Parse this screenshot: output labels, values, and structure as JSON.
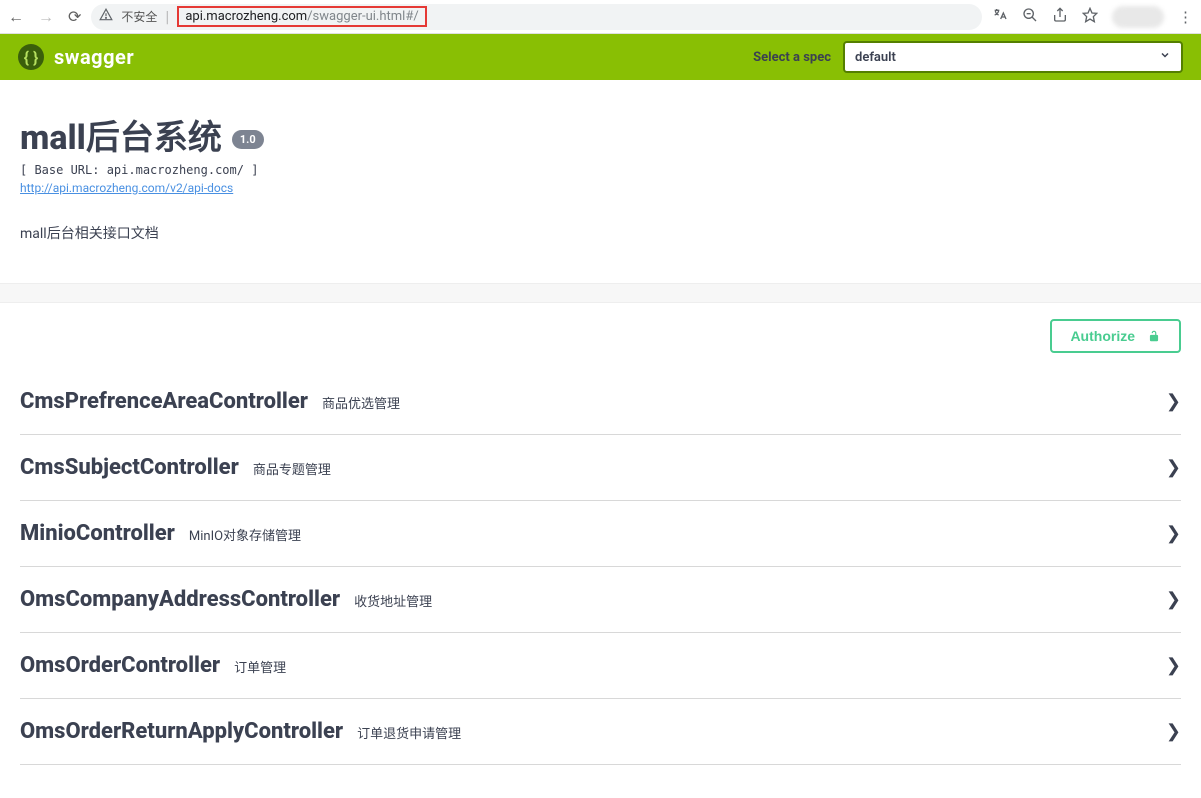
{
  "browser": {
    "insecure_label": "不安全",
    "url_primary": "api.macrozheng.com",
    "url_secondary": "/swagger-ui.html#/"
  },
  "topbar": {
    "brand": "swagger",
    "spec_label": "Select a spec",
    "spec_value": "default"
  },
  "info": {
    "title": "mall后台系统",
    "version": "1.0",
    "base_url": "[ Base URL: api.macrozheng.com/ ]",
    "docs_link": "http://api.macrozheng.com/v2/api-docs",
    "description": "mall后台相关接口文档"
  },
  "auth": {
    "label": "Authorize"
  },
  "tags": [
    {
      "name": "CmsPrefrenceAreaController",
      "desc": "商品优选管理"
    },
    {
      "name": "CmsSubjectController",
      "desc": "商品专题管理"
    },
    {
      "name": "MinioController",
      "desc": "MinIO对象存储管理"
    },
    {
      "name": "OmsCompanyAddressController",
      "desc": "收货地址管理"
    },
    {
      "name": "OmsOrderController",
      "desc": "订单管理"
    },
    {
      "name": "OmsOrderReturnApplyController",
      "desc": "订单退货申请管理"
    }
  ]
}
